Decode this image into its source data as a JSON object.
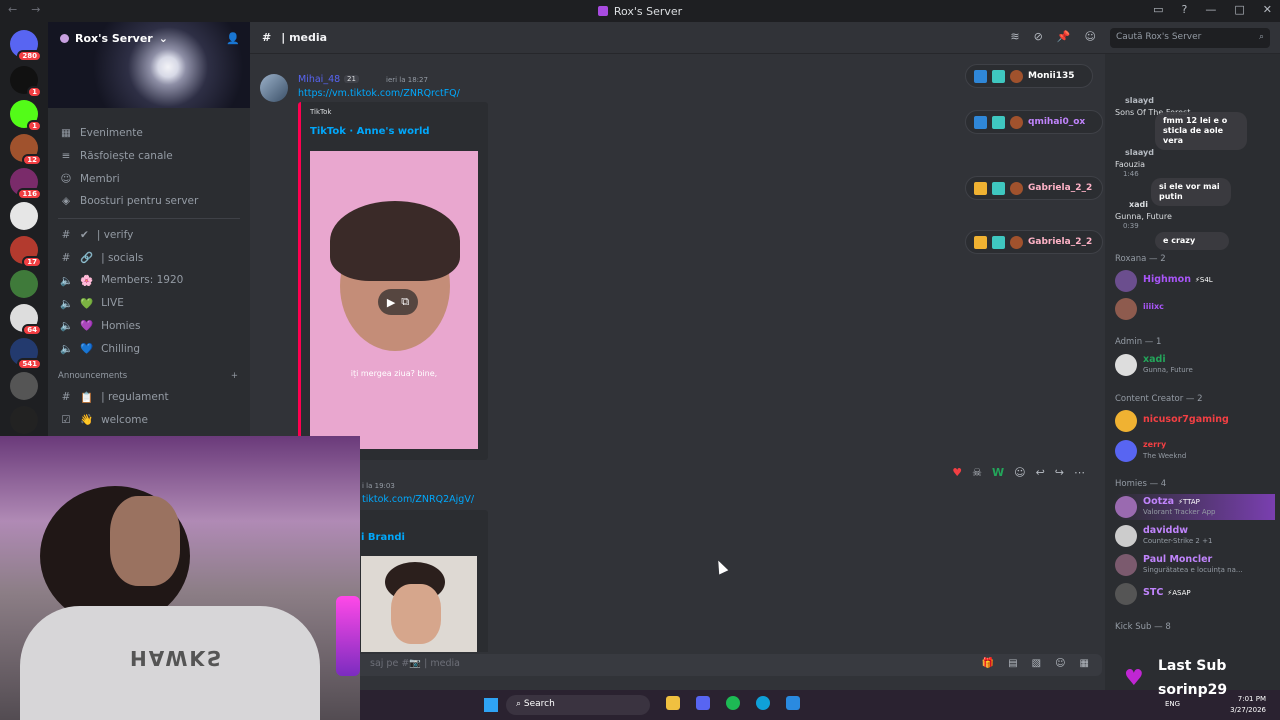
{
  "window": {
    "title": "Rox's Server"
  },
  "server": {
    "name": "Rox's Server"
  },
  "guild_badges": [
    "280",
    "1",
    "1",
    "12",
    "116",
    "17",
    "64",
    "541"
  ],
  "nav_items": [
    {
      "icon": "calendar-icon",
      "label": "Evenimente"
    },
    {
      "icon": "browse-channels-icon",
      "label": "Răsfoiește canale"
    },
    {
      "icon": "members-icon",
      "label": "Membri"
    },
    {
      "icon": "boost-icon",
      "label": "Boosturi pentru server"
    }
  ],
  "channels": [
    {
      "icon": "#",
      "emoji": "✔",
      "label": "| verify"
    },
    {
      "icon": "#",
      "emoji": "🔗",
      "label": "| socials"
    },
    {
      "icon": "🔈",
      "emoji": "🌸",
      "label": "Members: 1920"
    },
    {
      "icon": "🔈",
      "emoji": "💚",
      "label": "LIVE"
    },
    {
      "icon": "🔈",
      "emoji": "💜",
      "label": "Homies"
    },
    {
      "icon": "🔈",
      "emoji": "💙",
      "label": "Chilling"
    }
  ],
  "announcements_category": "Announcements",
  "announcement_channels": [
    {
      "icon": "#",
      "emoji": "📋",
      "label": "| regulament"
    },
    {
      "icon": "☑",
      "emoji": "👋",
      "label": "welcome"
    }
  ],
  "header": {
    "channel": "| media",
    "search_placeholder": "Caută Rox's Server"
  },
  "messages": [
    {
      "user": "Mihai_48",
      "tag": "21",
      "time": "ieri la 18:27",
      "link": "https://vm.tiktok.com/ZNRQrctFQ/",
      "provider": "TikTok",
      "embed_title": "TikTok · Anne's world",
      "subtitle": "iți mergea ziua? bine,"
    },
    {
      "time": "i la 19:03",
      "link": "tiktok.com/ZNRQ2AjgV/",
      "embed_title": "i Brandi"
    }
  ],
  "pills": [
    {
      "name": "Monii135",
      "color": "#ffffff",
      "accent": "#2f87d8"
    },
    {
      "name": "qmihai0_ox",
      "color": "#c084fc",
      "accent": "#2f87d8"
    },
    {
      "name": "Gabriela_2_2",
      "color": "#ffb3c7",
      "accent": "#f0b232"
    },
    {
      "name": "Gabriela_2_2",
      "color": "#ffb3c7",
      "accent": "#f0b232"
    }
  ],
  "bubbles": [
    "fmm 12 lei e o sticla de aole vera",
    "si ele vor mai putin",
    "e crazy"
  ],
  "activity_top": [
    {
      "name": "slaayd",
      "status": "Sons Of The Forest"
    },
    {
      "name": "slaayd",
      "status": "Faouzia",
      "time": "1:46"
    },
    {
      "name": "xadi",
      "status": "Gunna, Future",
      "time": "0:39"
    }
  ],
  "member_groups": [
    {
      "label": "Roxana — 2"
    },
    {
      "label": "Admin — 1"
    },
    {
      "label": "Content Creator — 2"
    },
    {
      "label": "Homies — 4"
    },
    {
      "label": "Kick Sub — 8"
    }
  ],
  "members": [
    {
      "name": "Highmon",
      "color": "#a855f7",
      "badge": "⚡S4L",
      "status": ""
    },
    {
      "name": "iiiixc",
      "color": "#a855f7",
      "badge": "",
      "status": ""
    },
    {
      "name": "xadi",
      "color": "#23a55a",
      "badge": "",
      "status": "Gunna, Future"
    },
    {
      "name": "nicusor7gaming",
      "color": "#f23f43",
      "badge": "",
      "status": ""
    },
    {
      "name": "zerry",
      "color": "#f23f43",
      "badge": "",
      "status": "The Weeknd"
    },
    {
      "name": "Ootza",
      "color": "#c084fc",
      "badge": "⚡TTAP",
      "status": "Valorant Tracker App"
    },
    {
      "name": "daviddw",
      "color": "#c084fc",
      "badge": "",
      "status": "Counter-Strike 2 +1"
    },
    {
      "name": "Paul Moncler",
      "color": "#c084fc",
      "badge": "",
      "status": "Singurătatea e locuința na..."
    },
    {
      "name": "STC",
      "color": "#c084fc",
      "badge": "⚡ASAP",
      "status": ""
    }
  ],
  "composer": {
    "placeholder": "saj pe #📷 | media"
  },
  "overlay": {
    "last_sub_label": "Last Sub",
    "last_sub_name": "sorinp29",
    "shirt_text": "HAWKS"
  },
  "taskbar": {
    "search": "Search",
    "lang": "ENG",
    "time": "7:01 PM",
    "date": "3/27/2026"
  }
}
